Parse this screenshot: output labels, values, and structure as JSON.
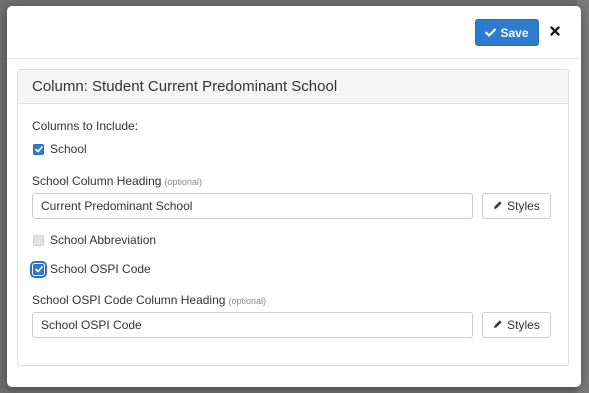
{
  "modal": {
    "save_label": "Save",
    "close_icon": "close-icon",
    "save_icon": "check-icon"
  },
  "panel": {
    "title": "Column: Student Current Predominant School",
    "columns_label": "Columns to Include:",
    "school": {
      "label": "School",
      "checked": true
    },
    "school_heading_label": "School Column Heading",
    "school_heading_optional": "(optional)",
    "school_heading_value": "Current Predominant School",
    "styles_label": "Styles",
    "school_abbrev": {
      "label": "School Abbreviation",
      "checked": false
    },
    "school_ospi": {
      "label": "School OSPI Code",
      "checked": true
    },
    "ospi_heading_label": "School OSPI Code Column Heading",
    "ospi_heading_optional": "(optional)",
    "ospi_heading_value": "School OSPI Code",
    "styles_label_2": "Styles"
  },
  "colors": {
    "primary": "#2e7bcf",
    "panel_heading_bg": "#f5f5f5"
  }
}
